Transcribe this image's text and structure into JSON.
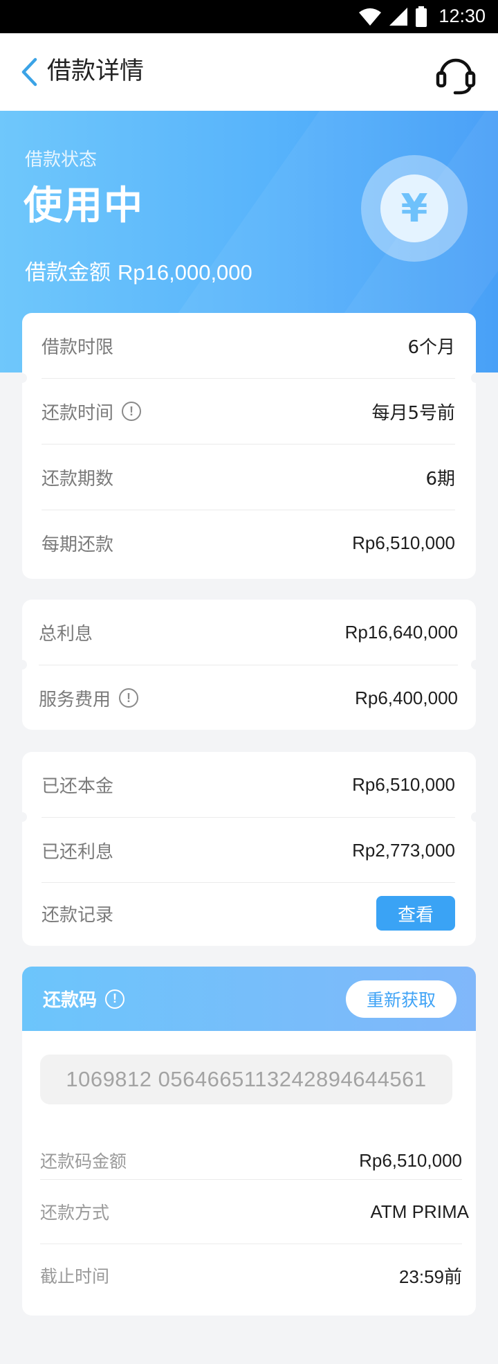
{
  "status_bar": {
    "time": "12:30"
  },
  "nav": {
    "title": "借款详情",
    "back_icon": "chevron-left-icon",
    "support_icon": "headset-icon"
  },
  "hero": {
    "status_label": "借款状态",
    "status_value": "使用中",
    "amount_label": "借款金额",
    "amount_value": "Rp16,000,000",
    "coin_glyph": "¥"
  },
  "loan_terms": [
    {
      "label": "借款时限",
      "value": "6个月",
      "info": false
    },
    {
      "label": "还款时间",
      "value": "每月5号前",
      "info": true
    },
    {
      "label": "还款期数",
      "value": "6期",
      "info": false
    },
    {
      "label": "每期还款",
      "value": "Rp6,510,000",
      "info": false
    }
  ],
  "fees": [
    {
      "label": "总利息",
      "value": "Rp16,640,000",
      "info": false
    },
    {
      "label": "服务费用",
      "value": "Rp6,400,000",
      "info": true
    }
  ],
  "repaid": [
    {
      "label": "已还本金",
      "value": "Rp6,510,000"
    },
    {
      "label": "已还利息",
      "value": "Rp2,773,000"
    },
    {
      "label": "还款记录",
      "button": "查看"
    }
  ],
  "repayment_code": {
    "title": "还款码",
    "refresh_label": "重新获取",
    "code": "1069812 0564665113242894644561",
    "rows": [
      {
        "label": "还款码金额",
        "value": "Rp6,510,000"
      },
      {
        "label": "还款方式",
        "value": "ATM PRIMA"
      },
      {
        "label": "截止时间",
        "value": "23:59前"
      }
    ]
  },
  "colors": {
    "accent": "#3aa3f5",
    "hero_start": "#6fc7fb",
    "hero_end": "#3f9bf7"
  }
}
